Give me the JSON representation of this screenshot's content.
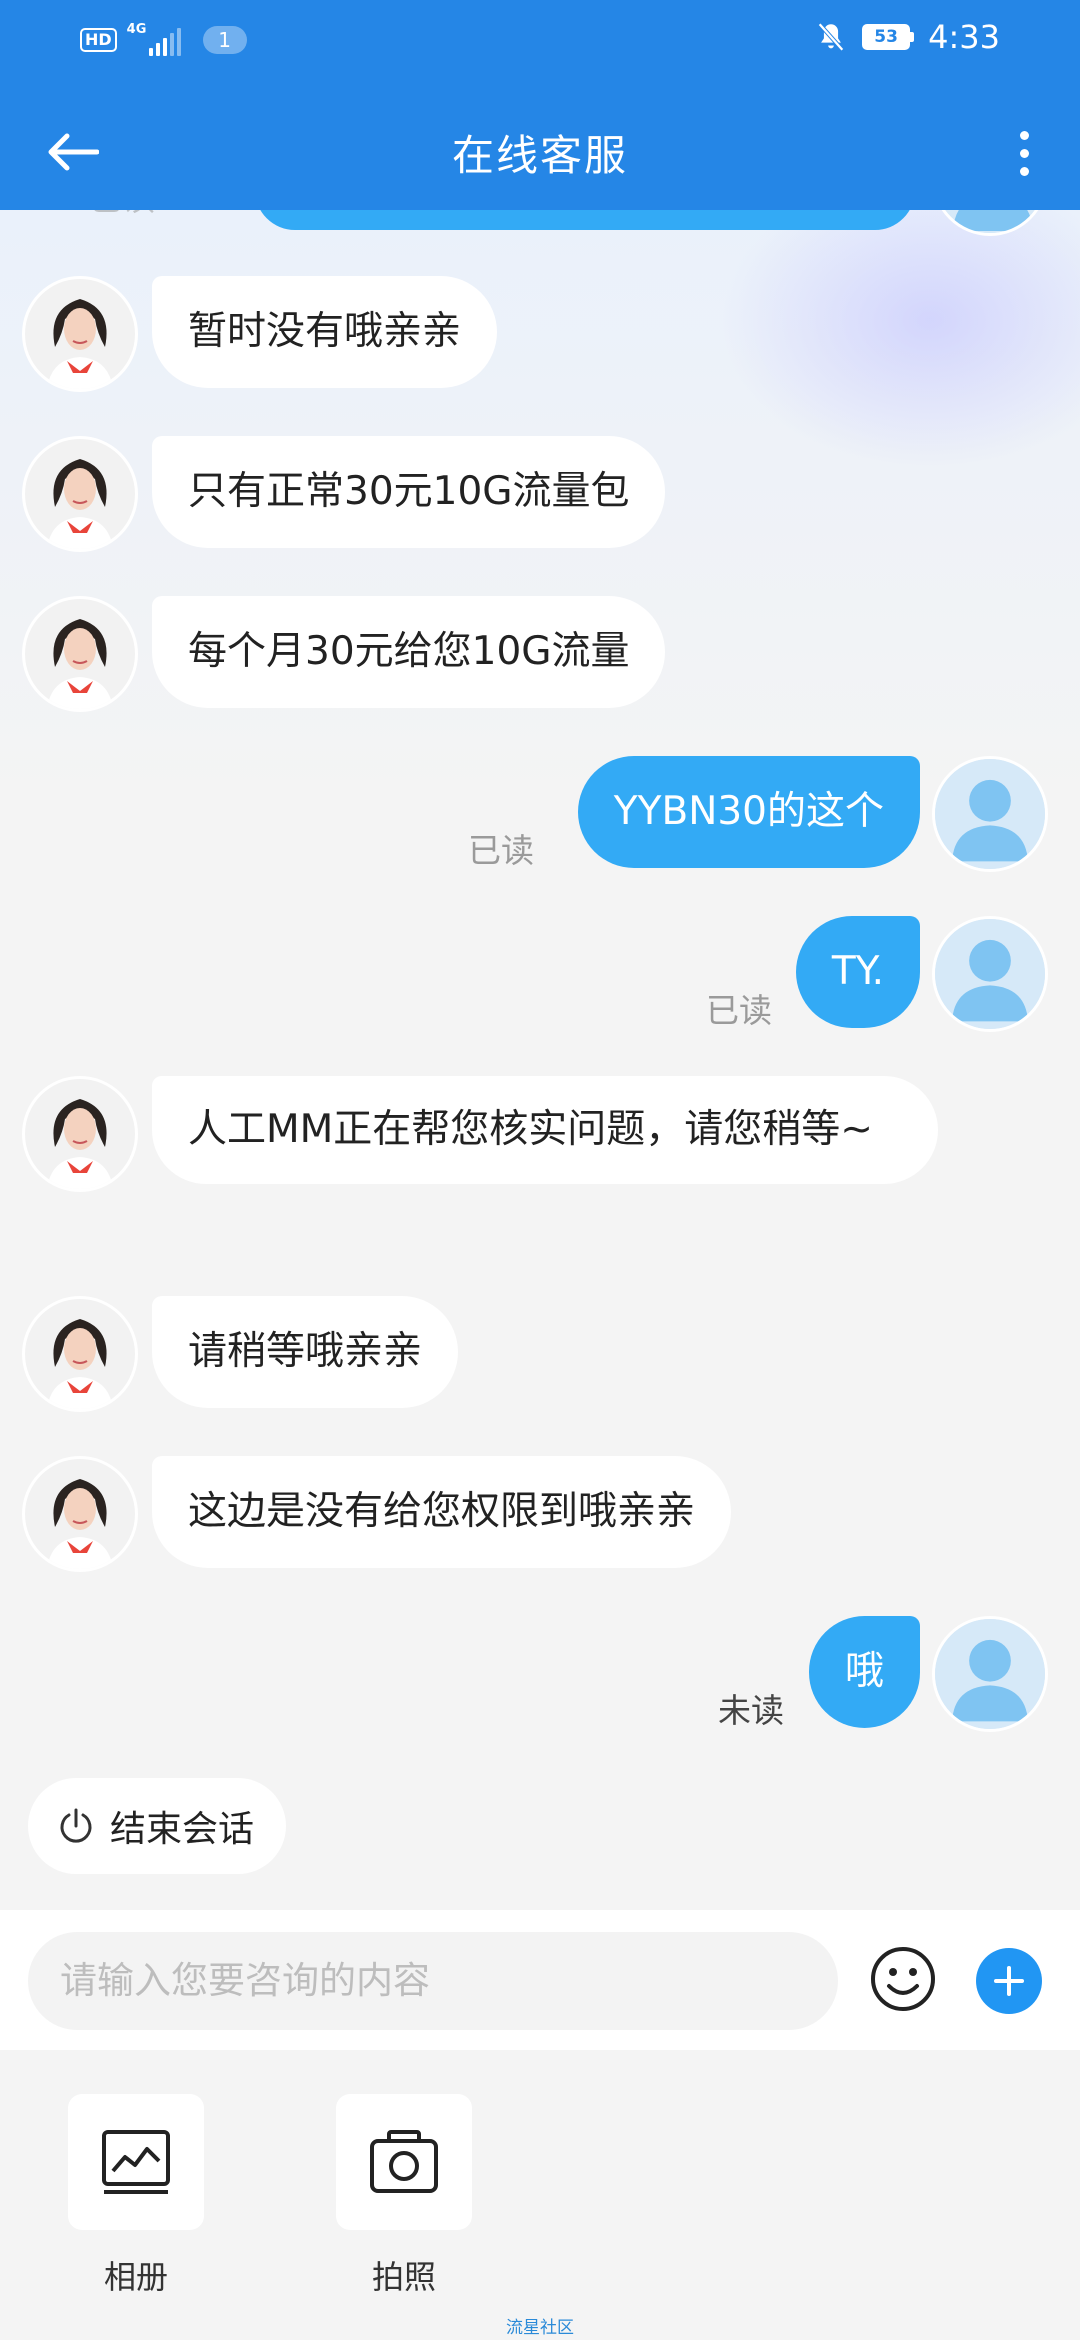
{
  "status_bar": {
    "hd": "HD",
    "network": "4G",
    "notification_count": "1",
    "battery": "53",
    "time": "4:33"
  },
  "nav": {
    "title": "在线客服",
    "back_icon": "arrow-left-icon",
    "more_icon": "more-vertical-icon"
  },
  "messages": {
    "partial_read": "已读",
    "agent_1": "暂时没有哦亲亲",
    "agent_2": "只有正常30元10G流量包",
    "agent_3": "每个月30元给您10G流量",
    "user_1": {
      "text": "YYBN30的这个",
      "status": "已读"
    },
    "user_2": {
      "text": "TY.",
      "status": "已读"
    },
    "agent_4": "人工MM正在帮您核实问题，请您稍等~",
    "agent_5": "请稍等哦亲亲",
    "agent_6": "这边是没有给您权限到哦亲亲",
    "user_3": {
      "text": "哦",
      "status": "未读"
    }
  },
  "end_session": {
    "label": "结束会话",
    "icon": "power-icon"
  },
  "input": {
    "placeholder": "请输入您要咨询的内容"
  },
  "tools": {
    "album": "相册",
    "camera": "拍照"
  },
  "watermark": "流星社区",
  "colors": {
    "header": "#2586e6",
    "user_bubble": "#33aaf5",
    "plus_button": "#2196f3"
  }
}
